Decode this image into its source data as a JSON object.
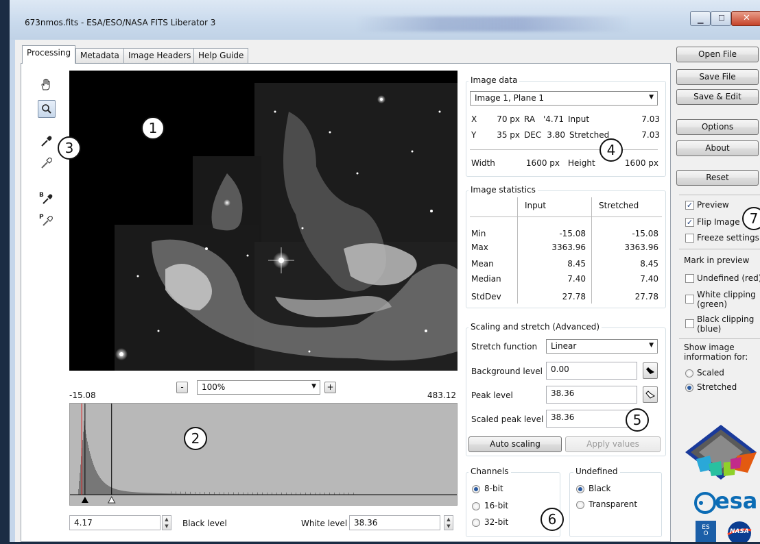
{
  "window": {
    "title": "673nmos.fits - ESA/ESO/NASA FITS Liberator 3"
  },
  "tabs": [
    {
      "label": "Processing",
      "active": true
    },
    {
      "label": "Metadata",
      "active": false
    },
    {
      "label": "Image Headers",
      "active": false
    },
    {
      "label": "Help Guide",
      "active": false
    }
  ],
  "callouts": [
    "1",
    "2",
    "3",
    "4",
    "5",
    "6",
    "7"
  ],
  "tools": {
    "b_label": "B",
    "p_label": "P"
  },
  "zoom": {
    "minus": "-",
    "plus": "+",
    "value": "100%"
  },
  "histogram": {
    "min_label": "-15.08",
    "max_label": "483.12",
    "black_level": 4.17,
    "white_level": 38.36,
    "black_level_value": "4.17",
    "white_level_value": "38.36",
    "black_level_label": "Black level",
    "white_level_label": "White level"
  },
  "image_data": {
    "title": "Image data",
    "plane_selected": "Image 1, Plane 1",
    "x_label": "X",
    "x_value": "70 px",
    "y_label": "Y",
    "y_value": "35 px",
    "ra_label": "RA",
    "ra_value": "'4.71",
    "dec_label": "DEC",
    "dec_value": "3.80",
    "input_label": "Input",
    "input_value": "7.03",
    "stretched_label": "Stretched",
    "stretched_value": "7.03",
    "width_label": "Width",
    "width_value": "1600 px",
    "height_label": "Height",
    "height_value": "1600 px"
  },
  "image_statistics": {
    "title": "Image statistics",
    "columns": [
      "Input",
      "Stretched"
    ],
    "rows": [
      {
        "label": "Min",
        "input": "-15.08",
        "stretched": "-15.08"
      },
      {
        "label": "Max",
        "input": "3363.96",
        "stretched": "3363.96"
      },
      {
        "label": "Mean",
        "input": "8.45",
        "stretched": "8.45"
      },
      {
        "label": "Median",
        "input": "7.40",
        "stretched": "7.40"
      },
      {
        "label": "StdDev",
        "input": "27.78",
        "stretched": "27.78"
      }
    ]
  },
  "scaling": {
    "title": "Scaling and stretch (Advanced)",
    "stretch_function_label": "Stretch function",
    "stretch_function_value": "Linear",
    "background_level_label": "Background level",
    "background_level_value": "0.00",
    "peak_level_label": "Peak level",
    "peak_level_value": "38.36",
    "scaled_peak_level_label": "Scaled peak level",
    "scaled_peak_level_value": "38.36",
    "auto_scaling": "Auto scaling",
    "apply_values": "Apply values"
  },
  "channels": {
    "title": "Channels",
    "options": [
      "8-bit",
      "16-bit",
      "32-bit"
    ],
    "selected": "8-bit"
  },
  "undefined": {
    "title": "Undefined",
    "options": [
      "Black",
      "Transparent"
    ],
    "selected": "Black"
  },
  "right_panel": {
    "open_file": "Open File",
    "save_file": "Save File",
    "save_edit": "Save & Edit",
    "options": "Options",
    "about": "About",
    "reset": "Reset",
    "preview": "Preview",
    "flip_image": "Flip Image",
    "freeze_settings": "Freeze settings",
    "mark_in_preview": "Mark in preview",
    "undefined_red": "Undefined (red)",
    "white_clipping": "White clipping (green)",
    "black_clipping": "Black clipping (blue)",
    "show_image_info": "Show image information for:",
    "scaled": "Scaled",
    "stretched": "Stretched",
    "checks": {
      "preview": true,
      "flip_image": true,
      "freeze_settings": false,
      "undefined_red": false,
      "white_clipping": false,
      "black_clipping": false
    },
    "info_selected": "Stretched"
  },
  "logos": {
    "esa": "esa",
    "eso": "ES O",
    "nasa": "NASA"
  },
  "colors": {
    "title_bar": "#c8d9ec",
    "histogram_bg": "#b8b8b8",
    "close_button": "#c6432a",
    "esa_blue": "#0b6cb5"
  }
}
